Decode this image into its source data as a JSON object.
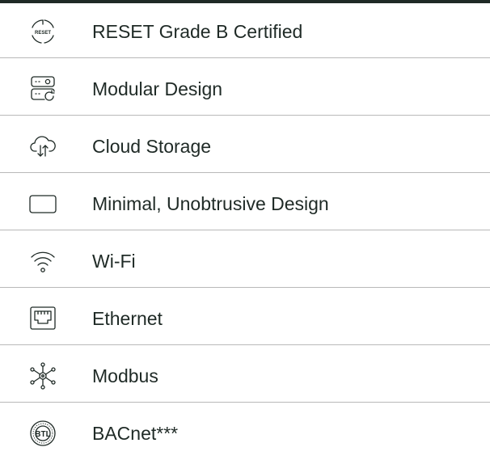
{
  "features": [
    {
      "label": "RESET Grade B Certified",
      "icon": "reset-certified-icon",
      "badge_text": "RESET"
    },
    {
      "label": "Modular Design",
      "icon": "modular-design-icon"
    },
    {
      "label": "Cloud Storage",
      "icon": "cloud-storage-icon"
    },
    {
      "label": "Minimal, Unobtrusive Design",
      "icon": "minimal-design-icon"
    },
    {
      "label": "Wi-Fi",
      "icon": "wifi-icon"
    },
    {
      "label": "Ethernet",
      "icon": "ethernet-icon"
    },
    {
      "label": "Modbus",
      "icon": "modbus-icon"
    },
    {
      "label": "BACnet***",
      "icon": "btl-icon",
      "badge_text": "BTL"
    }
  ],
  "colors": {
    "text": "#1f2a26",
    "icon_stroke": "#1f2a26",
    "divider": "#b9b9b9",
    "top_rule": "#1f2a26"
  }
}
